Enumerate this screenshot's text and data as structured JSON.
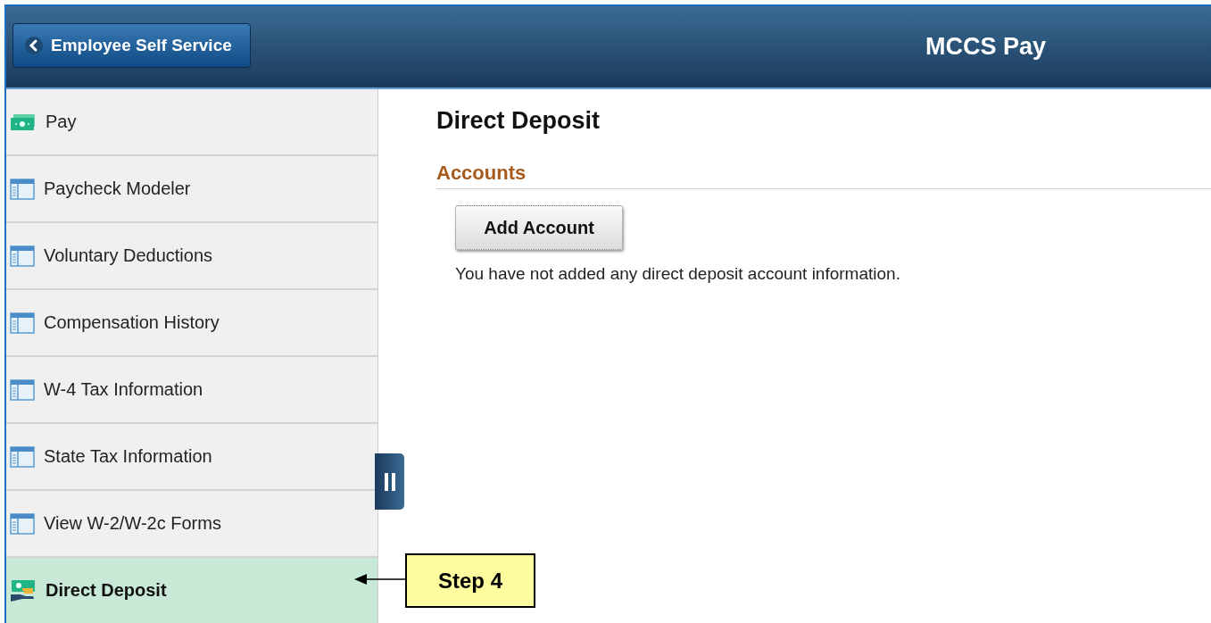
{
  "header": {
    "back_button": "Employee Self Service",
    "title": "MCCS Pay"
  },
  "sidebar": {
    "items": [
      {
        "label": "Pay",
        "kind": "money",
        "selected": false
      },
      {
        "label": "Paycheck Modeler",
        "kind": "page",
        "selected": false
      },
      {
        "label": "Voluntary Deductions",
        "kind": "page",
        "selected": false
      },
      {
        "label": "Compensation History",
        "kind": "page",
        "selected": false
      },
      {
        "label": "W-4 Tax Information",
        "kind": "page",
        "selected": false
      },
      {
        "label": "State Tax Information",
        "kind": "page",
        "selected": false
      },
      {
        "label": "View W-2/W-2c Forms",
        "kind": "page",
        "selected": false
      },
      {
        "label": "Direct Deposit",
        "kind": "deposit",
        "selected": true
      }
    ]
  },
  "content": {
    "title": "Direct Deposit",
    "section": "Accounts",
    "button": "Add Account",
    "message": "You have not added any direct deposit account information."
  },
  "callout": {
    "label": "Step 4"
  }
}
